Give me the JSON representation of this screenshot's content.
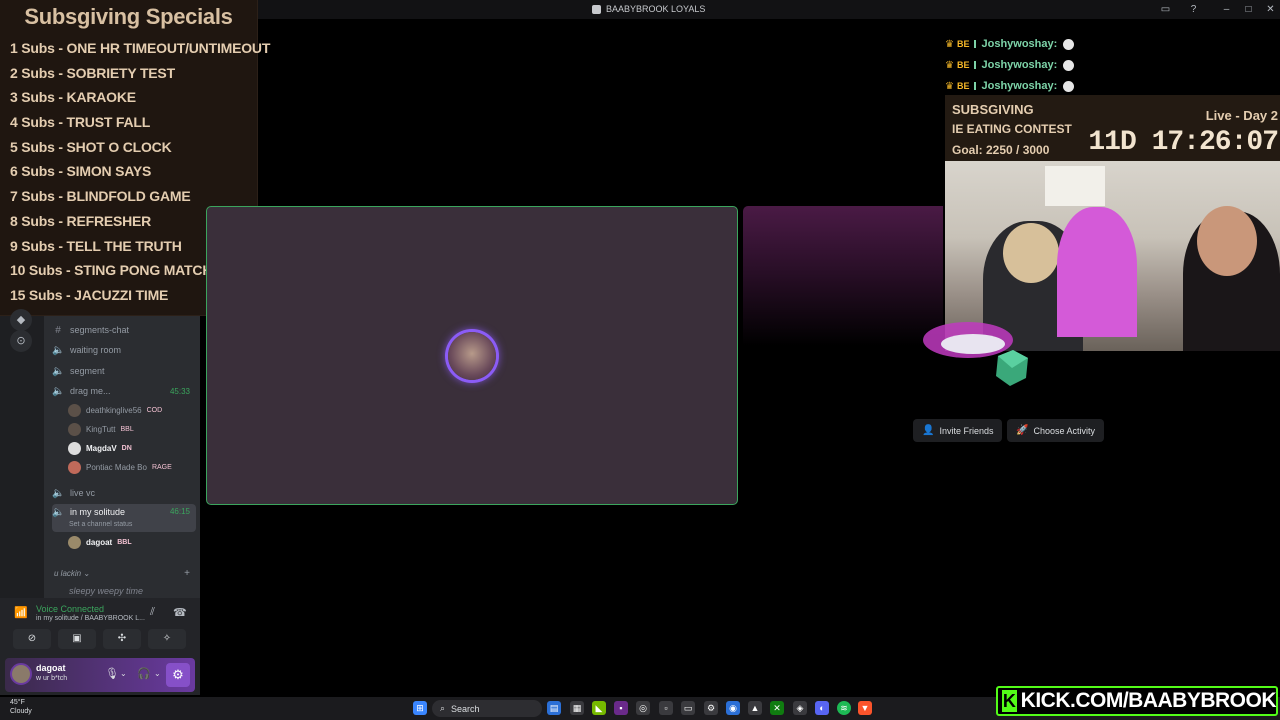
{
  "window": {
    "title": "BAABYBROOK LOYALS"
  },
  "subs_overlay": {
    "heading": "Subsgiving Specials",
    "items": [
      "1 Subs - ONE HR TIMEOUT/UNTIMEOUT",
      "2 Subs - SOBRIETY TEST",
      "3 Subs - KARAOKE",
      "4 Subs - TRUST FALL",
      "5 Subs - SHOT O CLOCK",
      "6 Subs - SIMON SAYS",
      "7 Subs - BLINDFOLD GAME",
      "8 Subs - REFRESHER",
      "9 Subs - TELL THE TRUTH",
      "10 Subs - STING PONG MATCH",
      "15 Subs - JACUZZI TIME"
    ]
  },
  "sidebar": {
    "channels": {
      "segments_chat": "segments-chat",
      "waiting_room": "waiting room",
      "segment": "segment",
      "drag_me": "drag me...",
      "drag_me_time": "45:33",
      "live_vc": "live vc",
      "in_my_solitude": "in my solitude",
      "in_my_solitude_time": "46:15",
      "channel_status_hint": "Set a channel status",
      "sleepy": "sleepy weepy time"
    },
    "drag_me_users": [
      {
        "name": "deathkinglive56",
        "tag": "COD"
      },
      {
        "name": "KingTutt",
        "tag": "BBL"
      },
      {
        "name": "MagdaV",
        "tag": "DN"
      },
      {
        "name": "Pontiac Made Bo",
        "tag": "RAGE"
      }
    ],
    "solitude_users": [
      {
        "name": "dagoat",
        "tag": "BBL"
      }
    ],
    "category": "u lackin"
  },
  "voice_panel": {
    "status": "Voice Connected",
    "location": "in my solitude / BAABYBROOK L..."
  },
  "user_panel": {
    "name": "dagoat",
    "status": "w ur b*tch"
  },
  "stage": {
    "invite_label": "Invite Friends",
    "activity_label": "Choose Activity"
  },
  "chat": {
    "lines": [
      {
        "badge": "BE",
        "user": "Joshywoshay:"
      },
      {
        "badge": "BE",
        "user": "Joshywoshay:"
      },
      {
        "badge": "BE",
        "user": "Joshywoshay:"
      }
    ]
  },
  "subsgiving_widget": {
    "title": "SUBSGIVING",
    "event": "IE EATING CONTEST",
    "goal": "Goal: 2250 / 3000",
    "live": "Live - Day 2",
    "timer": "11D 17:26:07"
  },
  "taskbar": {
    "temperature": "45°F",
    "weather": "Cloudy",
    "search_placeholder": "Search"
  },
  "kick_banner": {
    "url": "KICK.COM/BAABYBROOK"
  },
  "colors": {
    "discord_green": "#3ba55d",
    "accent_purple": "#8650c8",
    "kick_green": "#53fc18",
    "overlay_text": "#e4cdb0"
  }
}
